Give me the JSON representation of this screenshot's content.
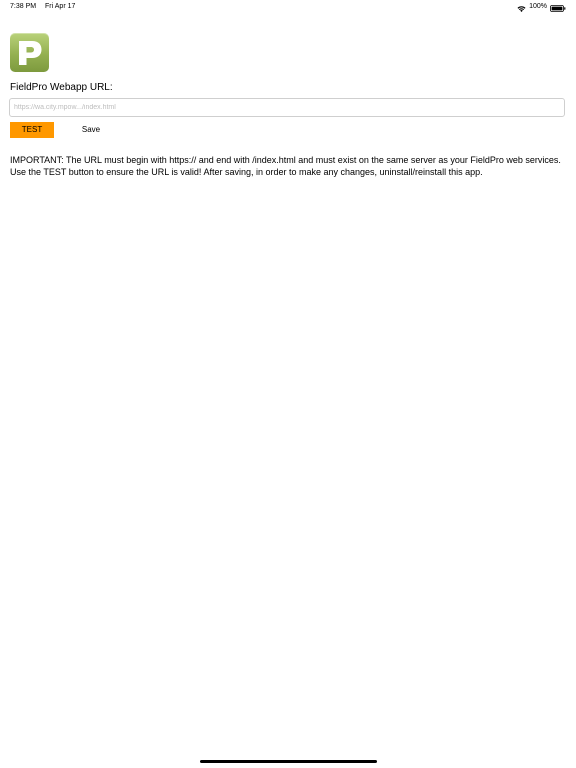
{
  "status_bar": {
    "time": "7:38 PM",
    "date": "Fri Apr 17",
    "battery": "100%"
  },
  "app": {
    "logo_letter": "P",
    "logo_icon": "fieldpro-logo-icon"
  },
  "form": {
    "url_label": "FieldPro Webapp URL:",
    "url_value": "",
    "url_placeholder": "https://wa.city.mpow.../index.html",
    "test_label": "TEST",
    "save_label": "Save"
  },
  "notice": {
    "text": "IMPORTANT: The URL must begin with https:// and end with /index.html and must exist on the same server as your FieldPro web services. Use the TEST button to ensure the URL is valid! After saving, in order to make any changes, uninstall/reinstall this app."
  },
  "colors": {
    "test_button": "#ff9800",
    "logo_green": "#94b050"
  }
}
